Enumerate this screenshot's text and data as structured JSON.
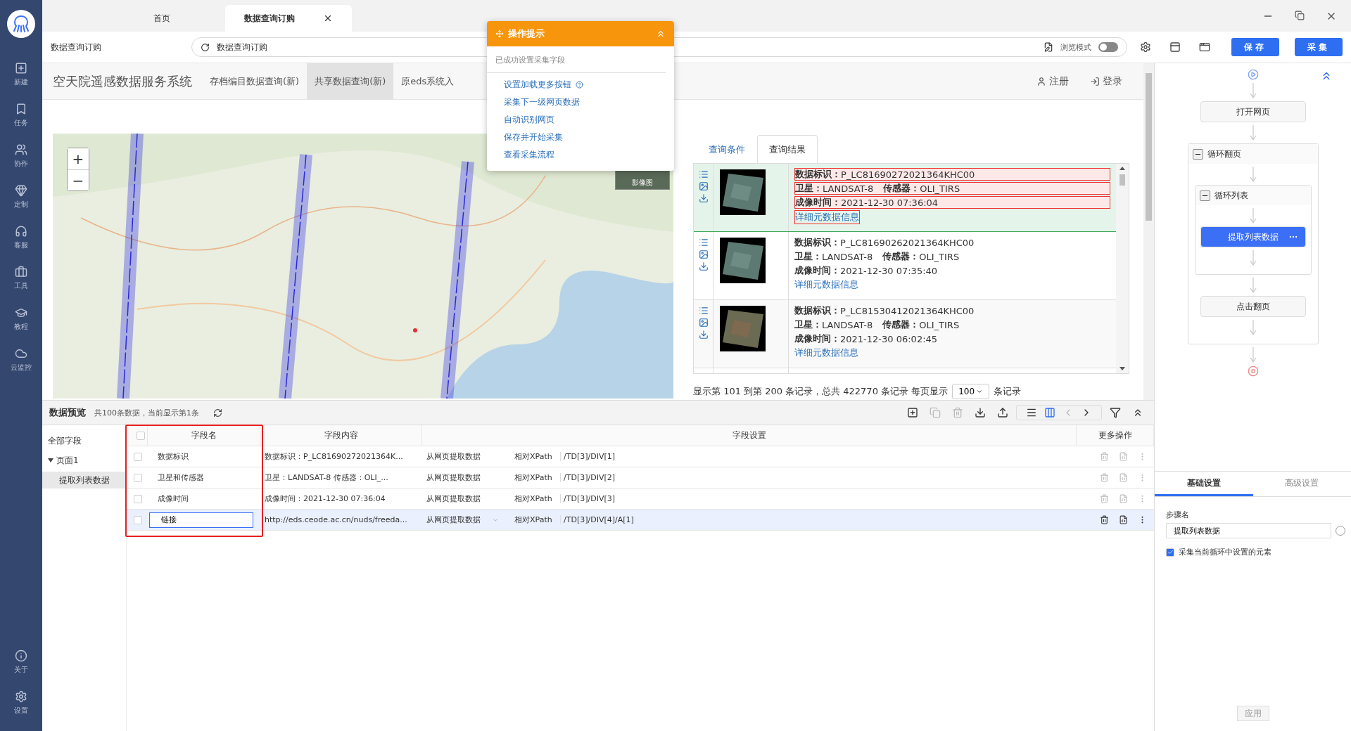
{
  "sidebar": {
    "items": [
      {
        "label": "新建"
      },
      {
        "label": "任务"
      },
      {
        "label": "协作"
      },
      {
        "label": "定制"
      },
      {
        "label": "客服"
      },
      {
        "label": "工具"
      },
      {
        "label": "教程"
      },
      {
        "label": "云监控"
      }
    ],
    "bottom_items": [
      {
        "label": "关于"
      },
      {
        "label": "设置"
      }
    ]
  },
  "tabs": [
    {
      "label": "首页",
      "selected": false,
      "closable": false
    },
    {
      "label": "数据查询订购",
      "selected": true,
      "closable": true
    }
  ],
  "address_bar": {
    "page_label": "数据查询订购",
    "url": "数据查询订购",
    "browse_mode": {
      "label": "浏览模式",
      "on": false
    }
  },
  "toolbar_buttons": [
    "保存",
    "采集"
  ],
  "site": {
    "title": "空天院遥感数据服务系统",
    "nav": [
      {
        "label": "存档编目数据查询(新)",
        "selected": false
      },
      {
        "label": "共享数据查询(新)",
        "selected": true
      },
      {
        "label": "原eds系统入",
        "selected": false
      }
    ],
    "links": [
      {
        "kind": "register",
        "label": "注册"
      },
      {
        "kind": "login",
        "label": "登录"
      }
    ]
  },
  "map": {
    "zoom_in": "+",
    "zoom_out": "−",
    "layer_label": "影像图"
  },
  "results": {
    "tabs": [
      {
        "label": "查询条件",
        "selected": false
      },
      {
        "label": "查询结果",
        "selected": true
      }
    ],
    "records": [
      {
        "id_label": "数据标识：",
        "id": "P_LC81690272021364KHC00",
        "satellite_label": "卫星：",
        "satellite": "LANDSAT-8",
        "sensor_label": "传感器：",
        "sensor": "OLI_TIRS",
        "time_label": "成像时间：",
        "time": "2021-12-30 07:36:04",
        "link": "详细元数据信息",
        "selected": true
      },
      {
        "id_label": "数据标识：",
        "id": "P_LC81690262021364KHC00",
        "satellite_label": "卫星：",
        "satellite": "LANDSAT-8",
        "sensor_label": "传感器：",
        "sensor": "OLI_TIRS",
        "time_label": "成像时间：",
        "time": "2021-12-30 07:35:40",
        "link": "详细元数据信息",
        "selected": false
      },
      {
        "id_label": "数据标识：",
        "id": "P_LC81530412021364KHC00",
        "satellite_label": "卫星：",
        "satellite": "LANDSAT-8",
        "sensor_label": "传感器：",
        "sensor": "OLI_TIRS",
        "time_label": "成像时间：",
        "time": "2021-12-30 06:02:45",
        "link": "详细元数据信息",
        "selected": false
      }
    ],
    "footer": {
      "text": "显示第 101 到第 200 条记录，总共 422770 条记录 每页显示",
      "page_size": "100",
      "suffix": "条记录"
    }
  },
  "popup": {
    "title": "操作提示",
    "status": "已成功设置采集字段",
    "actions": [
      {
        "label": "设置加载更多按钮",
        "help": true
      },
      {
        "label": "采集下一级网页数据",
        "help": false
      },
      {
        "label": "自动识别网页",
        "help": false
      },
      {
        "label": "保存并开始采集",
        "help": false
      },
      {
        "label": "查看采集流程",
        "help": false
      }
    ]
  },
  "preview": {
    "title": "数据预览",
    "summary": "共100条数据，当前显示第1条",
    "toolbar": [
      {
        "kind": "add",
        "disabled": false
      },
      {
        "kind": "copy",
        "disabled": true
      },
      {
        "kind": "delete",
        "disabled": true
      },
      {
        "kind": "download",
        "disabled": false
      },
      {
        "kind": "upload",
        "disabled": false
      },
      {
        "kind": "list",
        "selected": false
      },
      {
        "kind": "columns",
        "selected": true
      },
      {
        "kind": "prev",
        "disabled": true
      },
      {
        "kind": "next",
        "disabled": false
      },
      {
        "kind": "filter",
        "disabled": false
      },
      {
        "kind": "collapse",
        "disabled": false
      }
    ],
    "tree": {
      "label": "全部字段",
      "children": [
        {
          "label": "页面1",
          "expanded": true,
          "children": [
            {
              "label": "提取列表数据",
              "selected": true
            }
          ]
        }
      ]
    },
    "all_checked": false,
    "name_column_highlighted": true,
    "columns": [
      {
        "label": "字段名"
      },
      {
        "label": "字段内容"
      },
      {
        "label": "字段设置"
      },
      {
        "label": "更多操作"
      }
    ],
    "rows": [
      {
        "checked": false,
        "name": "数据标识",
        "content": "数据标识：P_LC81690272021364K...",
        "source": "从网页提取数据",
        "mode": "相对XPath",
        "xpath": "/TD[3]/DIV[1]",
        "selected": false,
        "editing": false
      },
      {
        "checked": false,
        "name": "卫星和传感器",
        "content": "卫星：LANDSAT-8   传感器：OLI_...",
        "source": "从网页提取数据",
        "mode": "相对XPath",
        "xpath": "/TD[3]/DIV[2]",
        "selected": false,
        "editing": false
      },
      {
        "checked": false,
        "name": "成像时间",
        "content": "成像时间：2021-12-30 07:36:04",
        "source": "从网页提取数据",
        "mode": "相对XPath",
        "xpath": "/TD[3]/DIV[3]",
        "selected": false,
        "editing": false
      },
      {
        "checked": false,
        "name": "链接",
        "content": "http://eds.ceode.ac.cn/nuds/freeda...",
        "source": "从网页提取数据",
        "mode": "相对XPath",
        "xpath": "/TD[3]/DIV[4]/A[1]",
        "selected": true,
        "editing": true
      }
    ]
  },
  "flow": {
    "steps": [
      {
        "kind": "action",
        "label": "打开网页",
        "selected": false
      },
      {
        "kind": "loop",
        "label": "循环翻页",
        "expanded": true,
        "children": [
          {
            "kind": "loop",
            "label": "循环列表",
            "expanded": true,
            "children": [
              {
                "kind": "action",
                "label": "提取列表数据",
                "selected": true
              }
            ]
          },
          {
            "kind": "action",
            "label": "点击翻页",
            "selected": false
          }
        ]
      }
    ]
  },
  "settings": {
    "tabs": [
      {
        "label": "基础设置",
        "selected": true
      },
      {
        "label": "高级设置",
        "selected": false
      }
    ],
    "step_name_label": "步骤名",
    "step_name": "提取列表数据",
    "option": {
      "label": "采集当前循环中设置的元素",
      "checked": true
    },
    "apply": "应用"
  }
}
